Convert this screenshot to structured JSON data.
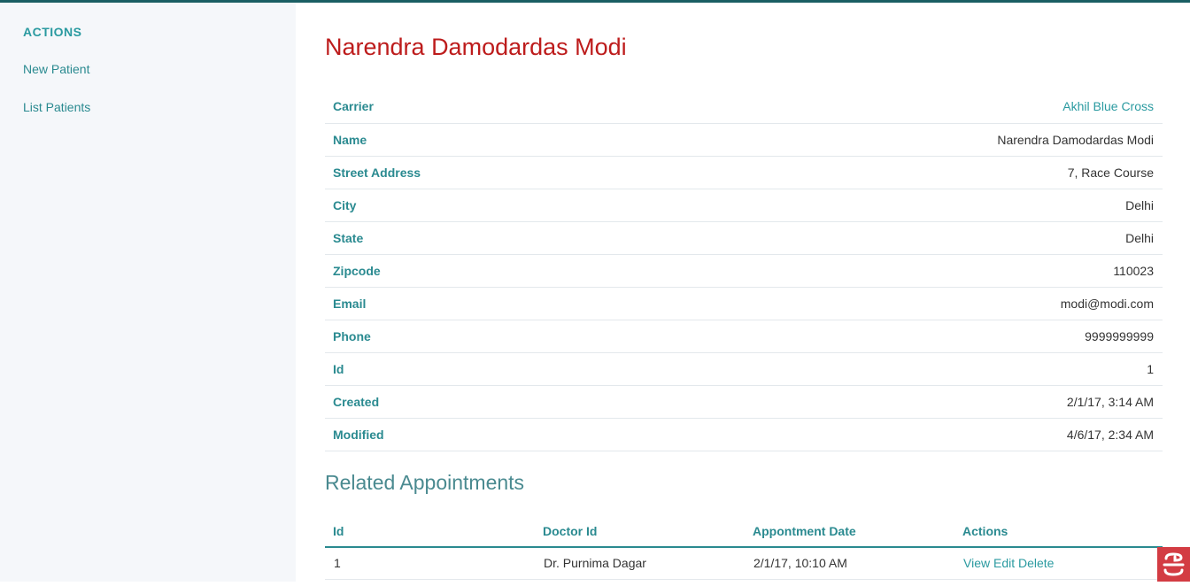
{
  "sidebar": {
    "heading": "ACTIONS",
    "items": [
      {
        "label": "New Patient"
      },
      {
        "label": "List Patients"
      }
    ]
  },
  "patient": {
    "title": "Narendra Damodardas Modi",
    "fields": [
      {
        "label": "Carrier",
        "value": "Akhil Blue Cross",
        "is_link": true
      },
      {
        "label": "Name",
        "value": "Narendra Damodardas Modi"
      },
      {
        "label": "Street Address",
        "value": "7, Race Course"
      },
      {
        "label": "City",
        "value": "Delhi"
      },
      {
        "label": "State",
        "value": "Delhi"
      },
      {
        "label": "Zipcode",
        "value": "110023"
      },
      {
        "label": "Email",
        "value": "modi@modi.com"
      },
      {
        "label": "Phone",
        "value": "9999999999"
      },
      {
        "label": "Id",
        "value": "1"
      },
      {
        "label": "Created",
        "value": "2/1/17, 3:14 AM"
      },
      {
        "label": "Modified",
        "value": "4/6/17, 2:34 AM"
      }
    ]
  },
  "related": {
    "title": "Related Appointments",
    "columns": [
      "Id",
      "Doctor Id",
      "Appontment Date",
      "Actions"
    ],
    "rows": [
      {
        "id": "1",
        "doctor": "Dr. Purnima Dagar",
        "date": "2/1/17, 10:10 AM",
        "view": "View",
        "edit": "Edit",
        "delete": "Delete"
      }
    ]
  },
  "colors": {
    "topbar": "#1a5e63",
    "accent": "#2a9aa0",
    "title_red": "#bd1c1c",
    "sidebar_bg": "#f5f7fa",
    "logo_red": "#d33c43"
  },
  "icons": {
    "logo": "cakephp-logo-icon"
  }
}
